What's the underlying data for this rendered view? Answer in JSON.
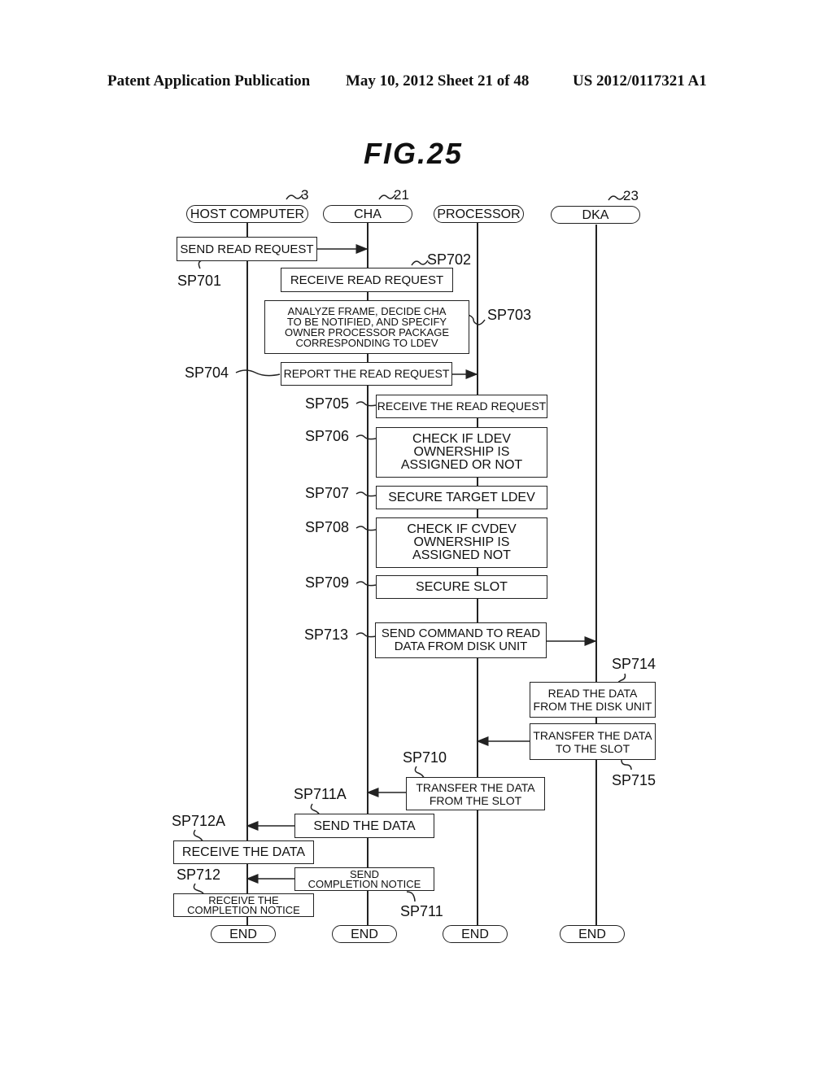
{
  "header": {
    "left": "Patent Application Publication",
    "middle": "May 10, 2012  Sheet 21 of 48",
    "right": "US 2012/0117321 A1"
  },
  "figure_title": "FIG.25",
  "actors": [
    {
      "name": "HOST COMPUTER",
      "ref": "3"
    },
    {
      "name": "CHA",
      "ref": "21"
    },
    {
      "name": "PROCESSOR",
      "ref": ""
    },
    {
      "name": "DKA",
      "ref": "23"
    }
  ],
  "steps": {
    "sp701": {
      "id": "SP701",
      "text": "SEND READ REQUEST"
    },
    "sp702": {
      "id": "SP702",
      "text": "RECEIVE READ REQUEST"
    },
    "sp703": {
      "id": "SP703",
      "text": "ANALYZE FRAME, DECIDE CHA\nTO BE NOTIFIED, AND SPECIFY\nOWNER PROCESSOR PACKAGE\nCORRESPONDING TO LDEV"
    },
    "sp704": {
      "id": "SP704",
      "text": "REPORT THE READ REQUEST"
    },
    "sp705": {
      "id": "SP705",
      "text": "RECEIVE THE READ REQUEST"
    },
    "sp706": {
      "id": "SP706",
      "text": "CHECK IF LDEV\nOWNERSHIP IS\nASSIGNED OR NOT"
    },
    "sp707": {
      "id": "SP707",
      "text": "SECURE TARGET LDEV"
    },
    "sp708": {
      "id": "SP708",
      "text": "CHECK IF CVDEV\nOWNERSHIP IS\nASSIGNED NOT"
    },
    "sp709": {
      "id": "SP709",
      "text": "SECURE SLOT"
    },
    "sp713": {
      "id": "SP713",
      "text": "SEND COMMAND TO READ\nDATA FROM DISK UNIT"
    },
    "sp714": {
      "id": "SP714",
      "text": "READ THE DATA\nFROM THE DISK UNIT"
    },
    "sp715": {
      "id": "SP715",
      "text": "TRANSFER THE DATA\nTO THE SLOT"
    },
    "sp710": {
      "id": "SP710",
      "text": "TRANSFER THE DATA\nFROM THE SLOT"
    },
    "sp711a": {
      "id": "SP711A",
      "text": "SEND THE DATA"
    },
    "sp712a": {
      "id": "SP712A",
      "text": "RECEIVE THE DATA"
    },
    "sp711": {
      "id": "SP711",
      "text": "SEND\nCOMPLETION NOTICE"
    },
    "sp712": {
      "id": "SP712",
      "text": "RECEIVE THE\nCOMPLETION NOTICE"
    }
  },
  "end_label": "END"
}
